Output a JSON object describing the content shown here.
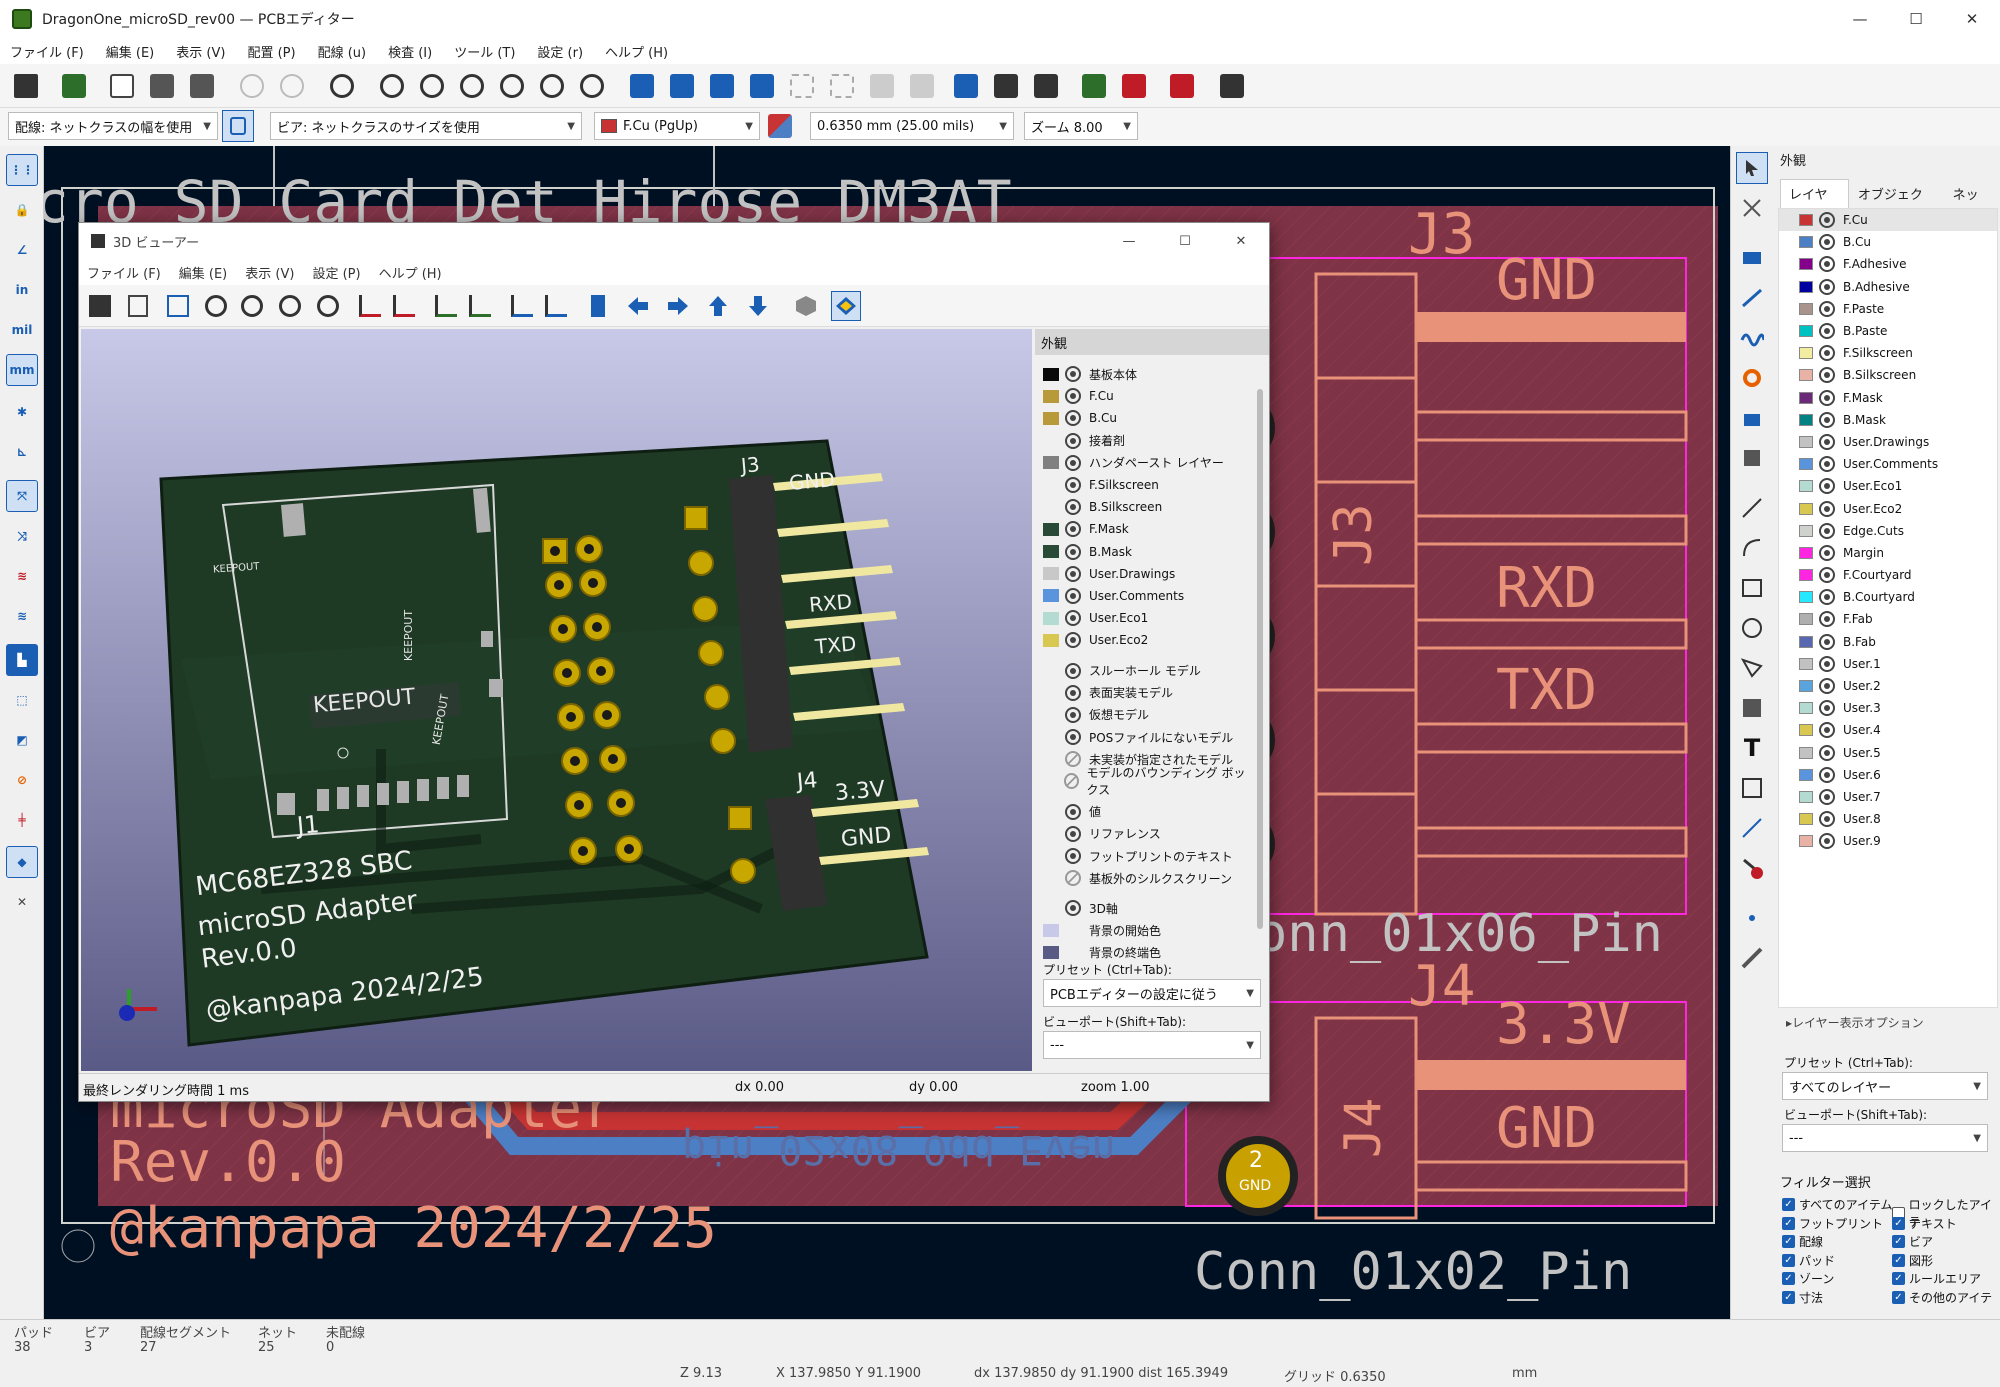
{
  "window": {
    "title": "DragonOne_microSD_rev00 — PCBエディター",
    "menu": [
      "ファイル (F)",
      "編集 (E)",
      "表示 (V)",
      "配置 (P)",
      "配線 (u)",
      "検査 (I)",
      "ツール (T)",
      "設定 (r)",
      "ヘルプ (H)"
    ]
  },
  "toolbar2": {
    "track_width": "配線: ネットクラスの幅を使用",
    "via_size": "ビア: ネットクラスのサイズを使用",
    "layer": "F.Cu (PgUp)",
    "grid": "0.6350 mm (25.00 mils)",
    "zoom": "ズーム 8.00"
  },
  "left_tools": {
    "in_label": "in",
    "mil_label": "mil",
    "mm_label": "mm"
  },
  "canvas": {
    "fp_title": "cro_SD_Card_Det_Hirose_DM3AT",
    "j3_ref": "J3",
    "j3_ref_vertical": "J3",
    "j3_gnd": "GND",
    "j3_rxd": "RXD",
    "j3_txd": "TXD",
    "j3_value": "onn_01x06_Pin",
    "j4_ref": "J4",
    "j4_ref_vertical": "J4",
    "j4_33v": "3.3V",
    "j4_gnd": "GND",
    "j4_value": "Conn_01x02_Pin",
    "pad2_num": "2",
    "pad2_net": "GND",
    "silk_line1": "microSD Adapter",
    "silk_line2": "Rev.0.0",
    "silk_line3": "@kanpapa 2024/2/25",
    "header_text": "pin_02x08_Odd_Even"
  },
  "appearance": {
    "header": "外観",
    "tabs": [
      "レイヤー",
      "オブジェクト",
      "ネット"
    ],
    "layers": [
      {
        "name": "F.Cu",
        "color": "#c83434"
      },
      {
        "name": "B.Cu",
        "color": "#4d7fc4"
      },
      {
        "name": "F.Adhesive",
        "color": "#84008a"
      },
      {
        "name": "B.Adhesive",
        "color": "#0000a0"
      },
      {
        "name": "F.Paste",
        "color": "#a8948c"
      },
      {
        "name": "B.Paste",
        "color": "#00c2c2"
      },
      {
        "name": "F.Silkscreen",
        "color": "#f2eda1"
      },
      {
        "name": "B.Silkscreen",
        "color": "#e8b2a7"
      },
      {
        "name": "F.Mask",
        "color": "#6a2a78"
      },
      {
        "name": "B.Mask",
        "color": "#028282"
      },
      {
        "name": "User.Drawings",
        "color": "#c2c2c2"
      },
      {
        "name": "User.Comments",
        "color": "#5994dc"
      },
      {
        "name": "User.Eco1",
        "color": "#b4dbd2"
      },
      {
        "name": "User.Eco2",
        "color": "#d8c852"
      },
      {
        "name": "Edge.Cuts",
        "color": "#d0d2cd"
      },
      {
        "name": "Margin",
        "color": "#ff26e2"
      },
      {
        "name": "F.Courtyard",
        "color": "#ff26e2"
      },
      {
        "name": "B.Courtyard",
        "color": "#26e9ff"
      },
      {
        "name": "F.Fab",
        "color": "#afafaf"
      },
      {
        "name": "B.Fab",
        "color": "#5868b0"
      },
      {
        "name": "User.1",
        "color": "#c2c2c2"
      },
      {
        "name": "User.2",
        "color": "#59a4dc"
      },
      {
        "name": "User.3",
        "color": "#b4dbd2"
      },
      {
        "name": "User.4",
        "color": "#d8c852"
      },
      {
        "name": "User.5",
        "color": "#c2c2c2"
      },
      {
        "name": "User.6",
        "color": "#5994dc"
      },
      {
        "name": "User.7",
        "color": "#b4dbd2"
      },
      {
        "name": "User.8",
        "color": "#d8c852"
      },
      {
        "name": "User.9",
        "color": "#e8b2a7"
      }
    ],
    "layer_options": "レイヤー表示オプション",
    "preset_label": "プリセット (Ctrl+Tab):",
    "preset_value": "すべてのレイヤー",
    "viewport_label": "ビューポート(Shift+Tab):",
    "viewport_value": "---",
    "filter_header": "フィルター選択",
    "filters_left": [
      "すべてのアイテム",
      "フットプリント",
      "配線",
      "パッド",
      "ゾーン",
      "寸法"
    ],
    "filters_right": [
      "ロックしたアイテ",
      "テキスト",
      "ビア",
      "図形",
      "ルールエリア",
      "その他のアイテ"
    ]
  },
  "viewer": {
    "title": "3D ビューアー",
    "menu": [
      "ファイル (F)",
      "編集 (E)",
      "表示 (V)",
      "設定 (P)",
      "ヘルプ (H)"
    ],
    "appearance_header": "外観",
    "layers": [
      {
        "name": "基板本体",
        "color": "#0a0a0a"
      },
      {
        "name": "F.Cu",
        "color": "#b89a3a"
      },
      {
        "name": "B.Cu",
        "color": "#b89a3a"
      },
      {
        "name": "接着剤",
        "color": ""
      },
      {
        "name": "ハンダペースト レイヤー",
        "color": "#808080"
      },
      {
        "name": "F.Silkscreen",
        "color": "#f0f0f0"
      },
      {
        "name": "B.Silkscreen",
        "color": "#f0f0f0"
      },
      {
        "name": "F.Mask",
        "color": "#2a4a38"
      },
      {
        "name": "B.Mask",
        "color": "#2a4a38"
      },
      {
        "name": "User.Drawings",
        "color": "#c8c8c8"
      },
      {
        "name": "User.Comments",
        "color": "#5994dc"
      },
      {
        "name": "User.Eco1",
        "color": "#b4dbd2"
      },
      {
        "name": "User.Eco2",
        "color": "#d8c852"
      }
    ],
    "models": [
      "スルーホール モデル",
      "表面実装モデル",
      "仮想モデル",
      "POSファイルにないモデル",
      "未実装が指定されたモデル",
      "モデルのバウンディング ボックス"
    ],
    "models_off": [
      false,
      false,
      false,
      false,
      true,
      true
    ],
    "misc": [
      "値",
      "リファレンス",
      "フットプリントのテキスト",
      "基板外のシルクスクリーン"
    ],
    "misc_off": [
      false,
      false,
      false,
      true
    ],
    "axis": "3D軸",
    "bg_start": "背景の開始色",
    "bg_end": "背景の終端色",
    "preset_label": "プリセット (Ctrl+Tab):",
    "preset_value": "PCBエディターの設定に従う",
    "viewport_label": "ビューポート(Shift+Tab):",
    "viewport_value": "---",
    "status_render": "最終レンダリング時間 1 ms",
    "status_dx": "dx 0.00",
    "status_dy": "dy 0.00",
    "status_zoom": "zoom 1.00",
    "board": {
      "keepout_big": "KEEPOUT",
      "keepout_small": "KEEPOUT",
      "keepout_v1": "KEEPOUT",
      "keepout_v2": "KEEPOUT",
      "j1": "J1",
      "j3": "J3",
      "j4": "J4",
      "gnd": "GND",
      "rxd": "RXD",
      "txd": "TXD",
      "v33": "3.3V",
      "gnd2": "GND",
      "line1": "MC68EZ328 SBC",
      "line2": "microSD Adapter",
      "line3": "Rev.0.0",
      "line4": "@kanpapa 2024/2/25"
    }
  },
  "status": {
    "pad_label": "パッド",
    "pad_val": "38",
    "via_label": "ビア",
    "via_val": "3",
    "seg_label": "配線セグメント",
    "seg_val": "27",
    "net_label": "ネット",
    "net_val": "25",
    "unrouted_label": "未配線",
    "unrouted_val": "0",
    "z": "Z 9.13",
    "xy": "X 137.9850  Y 91.1900",
    "dxdy": "dx 137.9850  dy 91.1900  dist 165.3949",
    "grid": "グリッド 0.6350",
    "unit": "mm"
  }
}
